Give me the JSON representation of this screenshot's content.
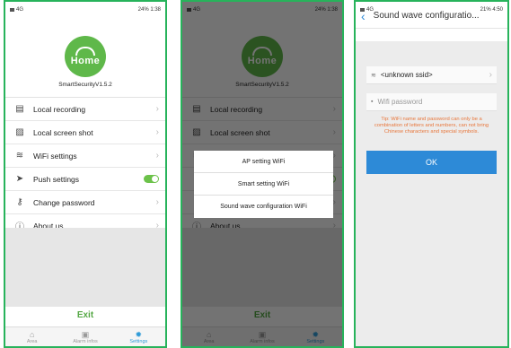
{
  "status": {
    "left_text": "4G",
    "right_text_1": "24% 1:38",
    "right_text_3": "21% 4:50"
  },
  "app": {
    "logo_text": "Home",
    "version": "SmartSecurityV1.5.2"
  },
  "menu": [
    {
      "label": "Local recording",
      "icon": "video-file-icon"
    },
    {
      "label": "Local screen shot",
      "icon": "image-icon"
    },
    {
      "label": "WiFi settings",
      "icon": "wifi-icon"
    },
    {
      "label": "Push settings",
      "icon": "send-icon",
      "toggle_on": true
    },
    {
      "label": "Change password",
      "icon": "key-icon"
    },
    {
      "label": "About us",
      "icon": "info-icon"
    }
  ],
  "exit_label": "Exit",
  "tabs": [
    {
      "label": "Area",
      "icon": "home-icon"
    },
    {
      "label": "Alarm infos",
      "icon": "alarm-icon"
    },
    {
      "label": "Settings",
      "icon": "gear-icon"
    }
  ],
  "dialog": {
    "options": [
      "AP setting WiFi",
      "Smart setting WiFi",
      "Sound wave configuration WiFi"
    ]
  },
  "sound_wave": {
    "title": "Sound wave configuratio...",
    "ssid_value": "<unknown ssid>",
    "password_placeholder": "Wifi password",
    "tip": "Tip: WiFi name and password can only be a combination of letters and numbers, can not bring Chinese characters and special symbols.",
    "ok_label": "OK"
  },
  "colors": {
    "accent_green": "#55a845",
    "blue": "#2d8ad7",
    "tip_orange": "#e8773c"
  }
}
